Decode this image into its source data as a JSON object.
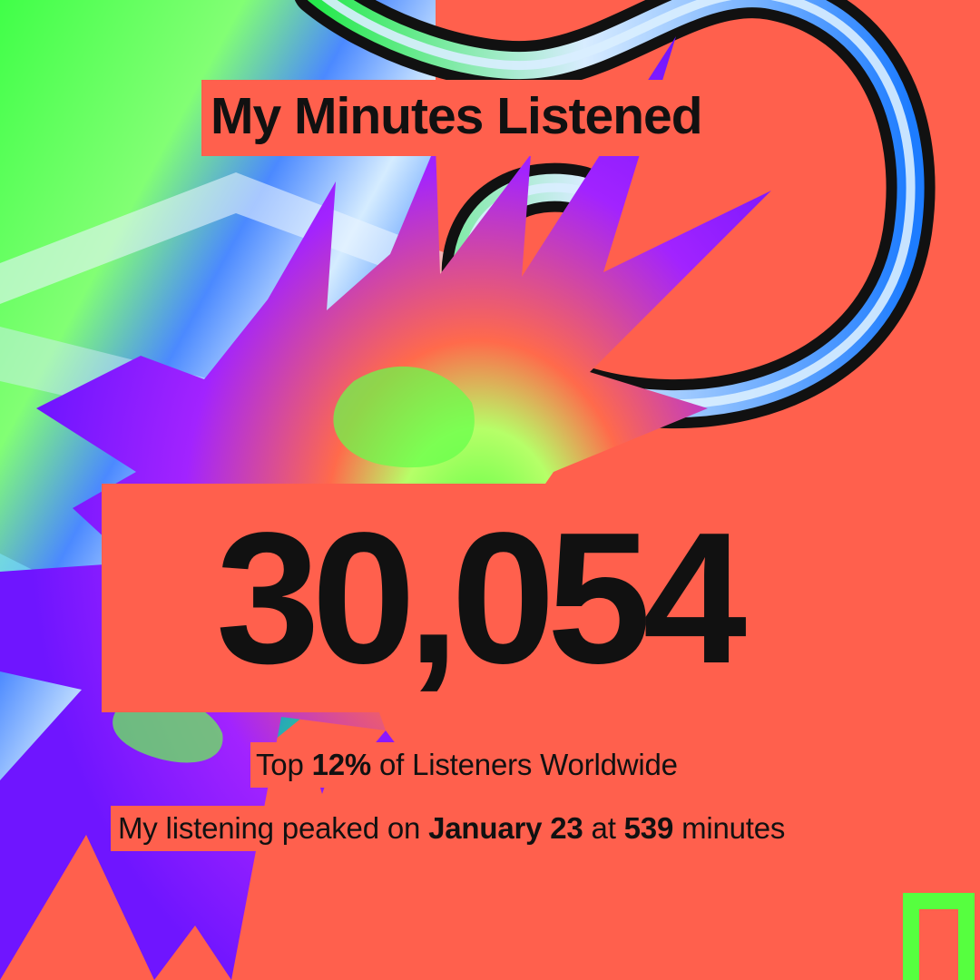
{
  "header": {
    "title": "My Minutes Listened"
  },
  "summary": {
    "minutes": "30,054",
    "top_prefix": "Top ",
    "top_percent": "12%",
    "top_suffix": " of Listeners Worldwide",
    "peak_prefix": "My listening peaked on ",
    "peak_date": "January 23",
    "peak_middle": " at ",
    "peak_minutes": "539",
    "peak_suffix": " minutes"
  },
  "theme": {
    "background": "#ff604d",
    "text": "#111111",
    "green": "#40ff48",
    "blue": "#2f7dff",
    "purple": "#8b18ff",
    "light_blue": "#cbe7ff"
  },
  "decorations": {
    "icons": [
      "gradient-panel-icon",
      "loop-ribbon-icon",
      "spiky-burst-icon",
      "green-corner-bracket-icon"
    ]
  }
}
